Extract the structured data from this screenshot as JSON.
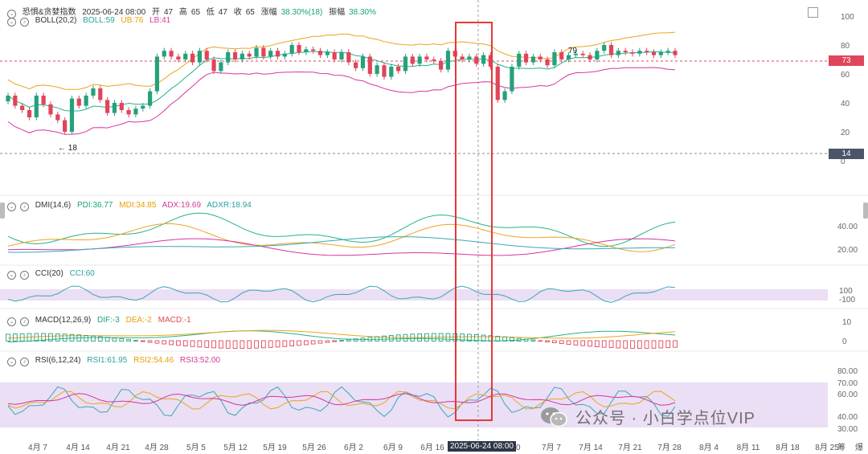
{
  "header": {
    "index_name": "恐惧&贪婪指数",
    "datetime": "2025-06-24 08:00",
    "open_label": "开",
    "open_value": "47",
    "high_label": "高",
    "high_value": "65",
    "low_label": "低",
    "low_value": "47",
    "close_label": "收",
    "close_value": "65",
    "change_label": "涨幅",
    "change_value": "38.30%(18)",
    "amplitude_label": "振幅",
    "amplitude_value": "38.30%"
  },
  "indicators": {
    "boll": {
      "name": "BOLL(20,2)",
      "boll": "BOLL:59",
      "ub": "UB:76",
      "lb": "LB:41"
    },
    "dmi": {
      "name": "DMI(14,6)",
      "pdi": "PDI:36.77",
      "mdi": "MDI:34.85",
      "adx": "ADX:19.69",
      "adxr": "ADXR:18.94"
    },
    "cci": {
      "name": "CCI(20)",
      "cci": "CCI:60"
    },
    "macd": {
      "name": "MACD(12,26,9)",
      "dif": "DIF:-3",
      "dea": "DEA:-2",
      "macd": "MACD:-1"
    },
    "rsi": {
      "name": "RSI(6,12,24)",
      "rsi1": "RSI1:61.95",
      "rsi2": "RSI2:54.46",
      "rsi3": "RSI3:52.00"
    }
  },
  "price_tags": {
    "current": "73",
    "cursor": "14"
  },
  "cursor_date": "2025-06-24 08:00",
  "annotations": {
    "high_mark": "79",
    "low_mark": "18"
  },
  "watermark": "公众号 · 小白学点位VIP",
  "colors": {
    "up": "#26a17b",
    "down": "#e0455a",
    "mid": "#26b38a",
    "upper": "#eaa520",
    "lower": "#d6359f",
    "highlight": "#e53935",
    "band": "#e6d9f2"
  },
  "chart_data": {
    "type": "candlestick",
    "x_ticks": [
      "4月 7",
      "4月 14",
      "4月 21",
      "4月 28",
      "5月 5",
      "5月 12",
      "5月 19",
      "5月 26",
      "6月 2",
      "6月 9",
      "6月 16",
      "30",
      "7月 7",
      "7月 14",
      "7月 21",
      "7月 28",
      "8月 4",
      "8月 11",
      "8月 18",
      "8月 25"
    ],
    "x_extra": [
      "筹",
      "爆"
    ],
    "main_y_ticks": [
      "100",
      "80",
      "60",
      "40",
      "20",
      "0"
    ],
    "dmi_y_ticks": [
      "40.00",
      "20.00"
    ],
    "cci_y_ticks": [
      "100",
      "-100"
    ],
    "macd_y_ticks": [
      "10",
      "0"
    ],
    "rsi_y_ticks": [
      "80.00",
      "70.00",
      "60.00",
      "40.00",
      "30.00"
    ],
    "highlighted_date": "2025-06-24",
    "series_close": [
      45,
      38,
      35,
      30,
      45,
      39,
      32,
      28,
      20,
      43,
      38,
      45,
      50,
      42,
      33,
      40,
      35,
      32,
      36,
      38,
      48,
      72,
      76,
      72,
      70,
      74,
      68,
      76,
      70,
      62,
      68,
      75,
      70,
      74,
      72,
      78,
      72,
      76,
      72,
      74,
      80,
      75,
      77,
      76,
      73,
      75,
      70,
      75,
      68,
      64,
      72,
      60,
      66,
      58,
      65,
      62,
      72,
      67,
      72,
      70,
      69,
      63,
      76,
      72,
      70,
      72,
      67,
      73,
      65,
      42,
      48,
      65,
      74,
      68,
      72,
      70,
      66,
      75,
      70,
      73,
      74,
      73,
      70,
      76,
      80,
      73,
      76,
      75,
      74,
      76,
      75,
      73,
      75,
      76,
      73
    ]
  }
}
